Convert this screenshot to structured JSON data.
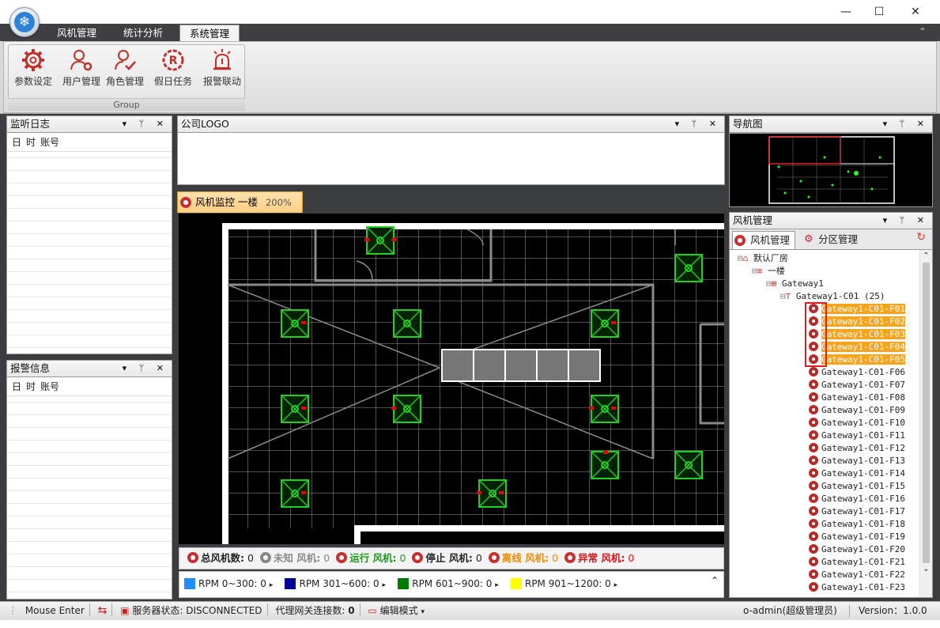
{
  "window": {
    "minimize": "—",
    "maximize": "☐",
    "close": "✕"
  },
  "ribbon": {
    "tabs": [
      {
        "label": "风机管理"
      },
      {
        "label": "统计分析"
      },
      {
        "label": "系统管理"
      }
    ],
    "buttons": [
      {
        "label": "参数设定"
      },
      {
        "label": "用户管理"
      },
      {
        "label": "角色管理"
      },
      {
        "label": "假日任务"
      },
      {
        "label": "报警联动"
      }
    ],
    "group_label": "Group",
    "collapse": "⌃"
  },
  "panels": {
    "monitor_log": {
      "title": "监听日志",
      "cols": [
        "日",
        "时",
        "账号"
      ]
    },
    "alarm_info": {
      "title": "报警信息",
      "cols": [
        "日",
        "时",
        "账号"
      ]
    },
    "company_logo": {
      "title": "公司LOGO"
    },
    "nav": {
      "title": "导航图"
    },
    "fan_mgmt": {
      "title": "风机管理",
      "tabs": [
        "风机管理",
        "分区管理"
      ]
    },
    "header_icons": "▾ ᛘ ✕"
  },
  "monitor": {
    "tab_label": "风机监控 一楼",
    "zoom": "200%"
  },
  "stats": {
    "total_label": "总风机数:",
    "total": "0",
    "unknown_label": "未知 风机:",
    "unknown": "0",
    "running_label": "运行 风机:",
    "running": "0",
    "stopped_label": "停止 风机:",
    "stopped": "0",
    "offline_label": "离线 风机:",
    "offline": "0",
    "abnormal_label": "异常 风机:",
    "abnormal": "0"
  },
  "rpm": [
    {
      "label": "RPM 0~300:",
      "value": "0",
      "color": "#1e8fff"
    },
    {
      "label": "RPM 301~600:",
      "value": "0",
      "color": "#000099"
    },
    {
      "label": "RPM 601~900:",
      "value": "0",
      "color": "#007a00"
    },
    {
      "label": "RPM 901~1200:",
      "value": "0",
      "color": "#ffff00"
    }
  ],
  "tree": {
    "root": "默认厂房",
    "floor": "一楼",
    "gateway": "Gateway1",
    "group": "Gateway1-C01  (25)",
    "items": [
      "Gateway1-C01-F01",
      "Gateway1-C01-F02",
      "Gateway1-C01-F03",
      "Gateway1-C01-F04",
      "Gateway1-C01-F05",
      "Gateway1-C01-F06",
      "Gateway1-C01-F07",
      "Gateway1-C01-F08",
      "Gateway1-C01-F09",
      "Gateway1-C01-F10",
      "Gateway1-C01-F11",
      "Gateway1-C01-F12",
      "Gateway1-C01-F13",
      "Gateway1-C01-F14",
      "Gateway1-C01-F15",
      "Gateway1-C01-F16",
      "Gateway1-C01-F17",
      "Gateway1-C01-F18",
      "Gateway1-C01-F19",
      "Gateway1-C01-F20",
      "Gateway1-C01-F21",
      "Gateway1-C01-F22",
      "Gateway1-C01-F23"
    ],
    "selected_count": 5
  },
  "statusbar": {
    "mouse": "Mouse Enter",
    "server_label": "服务器状态:",
    "server_status": "DISCONNECTED",
    "proxy_label": "代理网关连接数:",
    "proxy_count": "0",
    "edit_mode": "编辑模式",
    "user": "o-admin(超级管理员)",
    "version": "Version：1.0.0"
  },
  "colors": {
    "accent": "#f7a31c",
    "fan_green": "#22d022",
    "dark_bg": "#3a3c40"
  }
}
